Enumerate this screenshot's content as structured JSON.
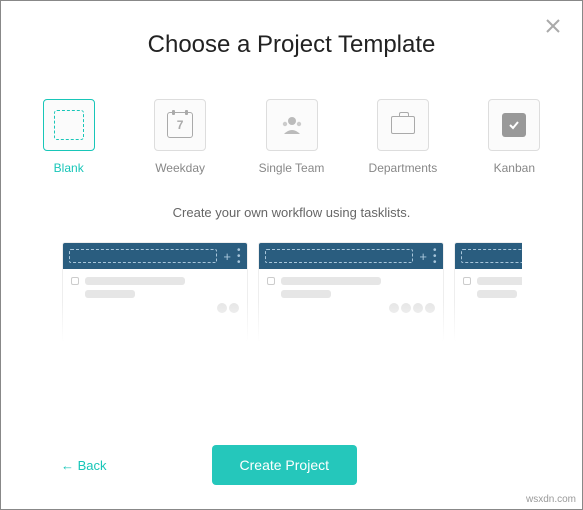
{
  "modal": {
    "title": "Choose a Project Template",
    "description": "Create your own workflow using tasklists.",
    "templates": [
      {
        "id": "blank",
        "label": "Blank",
        "selected": true
      },
      {
        "id": "weekday",
        "label": "Weekday",
        "calendar_num": "7",
        "selected": false
      },
      {
        "id": "single-team",
        "label": "Single Team",
        "selected": false
      },
      {
        "id": "departments",
        "label": "Departments",
        "selected": false
      },
      {
        "id": "kanban",
        "label": "Kanban",
        "selected": false
      }
    ]
  },
  "footer": {
    "back_label": "←  Back",
    "create_label": "Create Project"
  },
  "watermark": "wsxdn.com"
}
